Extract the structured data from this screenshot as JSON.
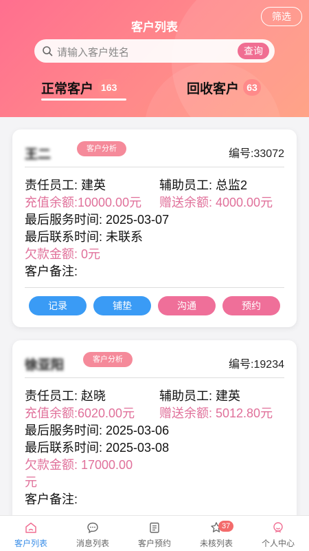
{
  "header": {
    "title": "客户列表",
    "filter_label": "筛选",
    "search_placeholder": "请输入客户姓名",
    "search_button": "查询"
  },
  "tabs": [
    {
      "label": "正常客户",
      "count": "163"
    },
    {
      "label": "回收客户",
      "count": "63"
    }
  ],
  "customers": [
    {
      "name": "王二",
      "tag": "客户分析",
      "id": "编号:33072",
      "staff": "责任员工: 建英",
      "assist": "辅助员工: 总监2",
      "recharge": "充值余额:10000.00元",
      "gift": "赠送余额: 4000.00元",
      "last_service": "最后服务时间: 2025-03-07",
      "last_contact": "最后联系时间: 未联系",
      "debt": "欠款金额: 0元",
      "remark": "客户备注:"
    },
    {
      "name": "徐亚阳",
      "tag": "客户分析",
      "id": "编号:19234",
      "staff": "责任员工: 赵晓",
      "assist": "辅助员工: 建英",
      "recharge": "充值余额:6020.00元",
      "gift": "赠送余额: 5012.80元",
      "last_service": "最后服务时间: 2025-03-06",
      "last_contact": "最后联系时间: 2025-03-08",
      "debt_line1": "欠款金额: 17000.00",
      "debt_line2": "元",
      "remark": "客户备注:"
    }
  ],
  "actions": [
    "记录",
    "铺垫",
    "沟通",
    "预约"
  ],
  "tabbar": [
    {
      "label": "客户列表",
      "icon": "customer-list-icon",
      "active": true
    },
    {
      "label": "消息列表",
      "icon": "message-icon"
    },
    {
      "label": "客户预约",
      "icon": "appointment-icon"
    },
    {
      "label": "未核列表",
      "icon": "star-icon",
      "badge": "37"
    },
    {
      "label": "个人中心",
      "icon": "profile-icon"
    }
  ],
  "colors": {
    "accent_pink": "#e0709a",
    "accent_blue": "#3a9bf5",
    "header_start": "#ff6f8f",
    "header_end": "#ff9a7a"
  }
}
